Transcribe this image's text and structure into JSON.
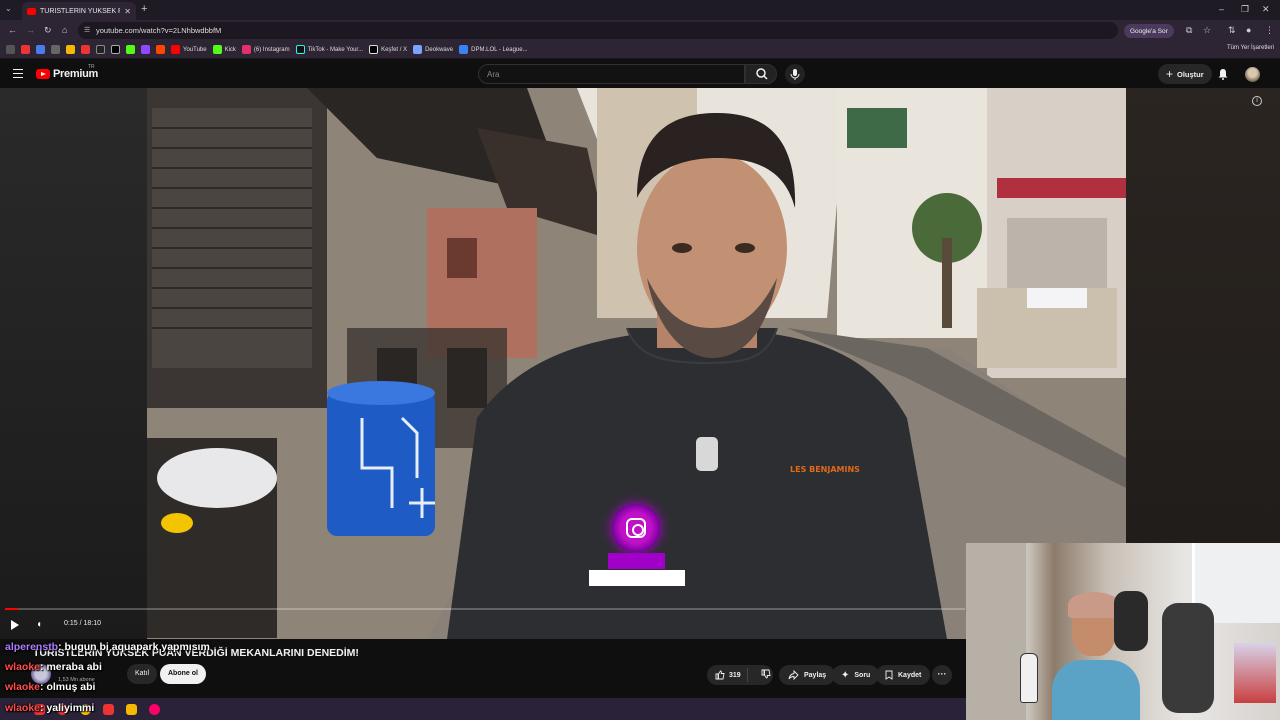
{
  "browser": {
    "tab_title": "TURİSTLERİN YÜKSEK PUAN VE",
    "new_tab": "+",
    "url": "youtube.com/watch?v=2LNhbwdbbfM",
    "google_ask": "Google'a Sor",
    "all_bookmarks": "Tüm Yer İşaretleri",
    "bookmarks": [
      {
        "label": "YouTube",
        "color": "#ff0000"
      },
      {
        "label": "Kick",
        "color": "#53fc18"
      },
      {
        "label": "(6) Instagram",
        "color": "#e1306c"
      },
      {
        "label": "TikTok - Make Your...",
        "color": "#25f4ee"
      },
      {
        "label": "Keşfet / X",
        "color": "#ffffff"
      },
      {
        "label": "Deokwave",
        "color": "#7aa2ff"
      },
      {
        "label": "DPM.LOL - League...",
        "color": "#3b82f6"
      }
    ],
    "bookmark_icon_colors": [
      "#e33",
      "#4a7cf0",
      "#888",
      "#f6b800",
      "#e33",
      "#333",
      "#fff",
      "#53fc18",
      "#8a2be2",
      "#ff4500"
    ]
  },
  "youtube": {
    "logo_text": "Premium",
    "region": "TR",
    "search_placeholder": "Ara",
    "create_label": "Oluştur"
  },
  "player": {
    "time": "0:15 / 18:10",
    "progress_fraction": 0.014,
    "title": "TURİSTLERİN YÜKSEK PUAN VERDİĞİ MEKANLARINI DENEDİM!",
    "channel_subs": "1,53 Mn abone",
    "channel_name": "",
    "join_label": "Katıl",
    "subscribe_label": "Abone ol",
    "likes": "319",
    "share_label": "Paylaş",
    "ask_label": "Soru",
    "save_label": "Kaydet",
    "more_label": "···"
  },
  "chat": [
    {
      "user": "alperenstb",
      "msg": ": bugun bi aquapark yapmısım",
      "color": "#b07cff"
    },
    {
      "user": "wlaoke",
      "msg": ": meraba abi",
      "color": "#ff4d4d"
    },
    {
      "user": "wlaoke",
      "msg": ": olmuş abi",
      "color": "#ff4d4d"
    },
    {
      "user": "wlaoke",
      "msg": ": yaliyimmi",
      "color": "#ff4d4d"
    }
  ],
  "taskbar_icon_colors": [
    "#e33",
    "#e33",
    "#4285f4",
    "#e33",
    "#f6b800",
    "#f06"
  ]
}
